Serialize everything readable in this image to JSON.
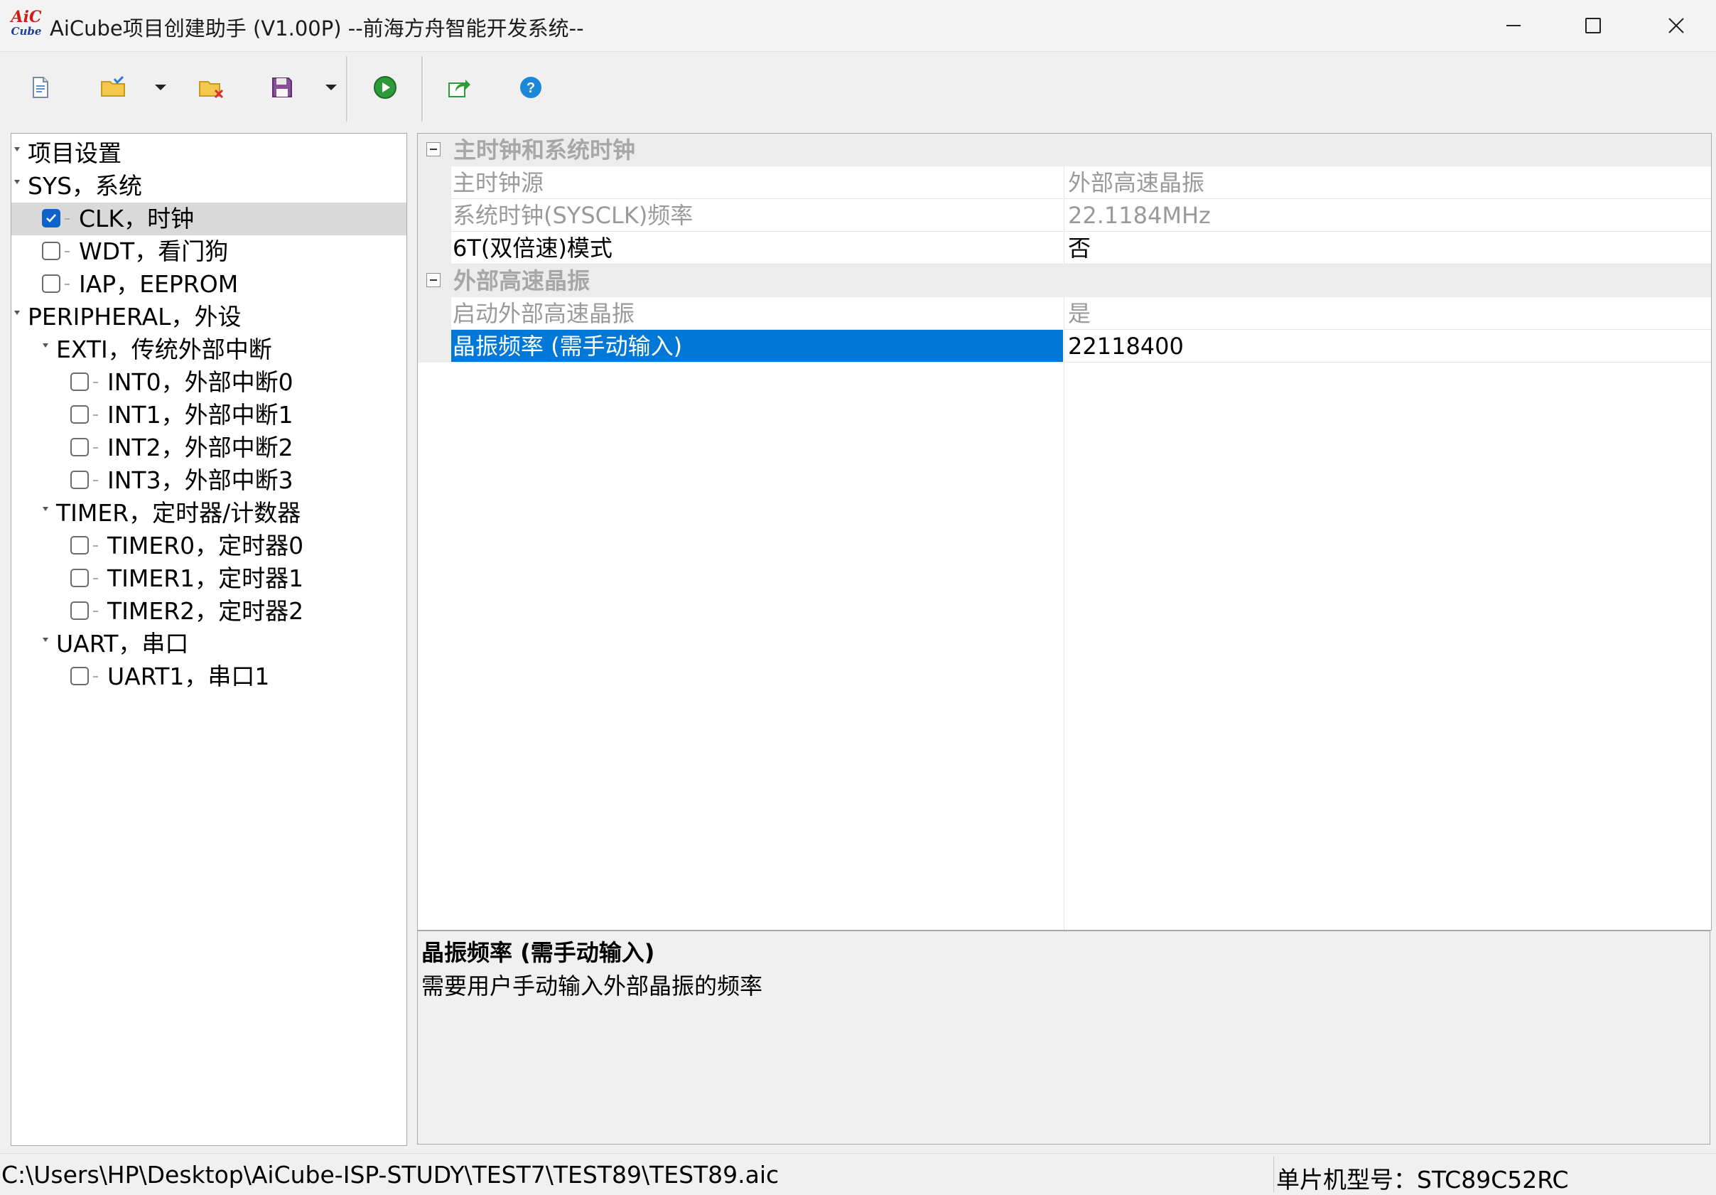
{
  "window": {
    "title": "AiCube项目创建助手 (V1.00P) --前海方舟智能开发系统--",
    "logo_line1": "AiC",
    "logo_line2": "Cube",
    "minimize": "minimize",
    "maximize": "maximize",
    "close": "close"
  },
  "toolbar": {
    "buttons": [
      {
        "name": "new-project",
        "icon": "new-document-icon"
      },
      {
        "name": "open-project",
        "icon": "open-folder-icon"
      },
      {
        "name": "close-project",
        "icon": "folder-delete-icon"
      },
      {
        "name": "save-project",
        "icon": "floppy-disk-icon"
      },
      {
        "name": "generate-code",
        "icon": "play-icon"
      },
      {
        "name": "export",
        "icon": "share-export-icon"
      },
      {
        "name": "help",
        "icon": "help-icon"
      }
    ]
  },
  "tree": {
    "nodes": [
      {
        "label": "项目设置",
        "level": 0,
        "checkbox": false,
        "checked": false,
        "selected": false
      },
      {
        "label": "SYS，系统",
        "level": 0,
        "checkbox": false,
        "checked": false,
        "selected": false
      },
      {
        "label": "CLK，时钟",
        "level": 1,
        "checkbox": true,
        "checked": true,
        "selected": true
      },
      {
        "label": "WDT，看门狗",
        "level": 1,
        "checkbox": true,
        "checked": false,
        "selected": false
      },
      {
        "label": "IAP，EEPROM",
        "level": 1,
        "checkbox": true,
        "checked": false,
        "selected": false
      },
      {
        "label": "PERIPHERAL，外设",
        "level": 0,
        "checkbox": false,
        "checked": false,
        "selected": false
      },
      {
        "label": "EXTI，传统外部中断",
        "level": 1,
        "checkbox": false,
        "checked": false,
        "selected": false
      },
      {
        "label": "INT0，外部中断0",
        "level": 2,
        "checkbox": true,
        "checked": false,
        "selected": false
      },
      {
        "label": "INT1，外部中断1",
        "level": 2,
        "checkbox": true,
        "checked": false,
        "selected": false
      },
      {
        "label": "INT2，外部中断2",
        "level": 2,
        "checkbox": true,
        "checked": false,
        "selected": false
      },
      {
        "label": "INT3，外部中断3",
        "level": 2,
        "checkbox": true,
        "checked": false,
        "selected": false
      },
      {
        "label": "TIMER，定时器/计数器",
        "level": 1,
        "checkbox": false,
        "checked": false,
        "selected": false
      },
      {
        "label": "TIMER0，定时器0",
        "level": 2,
        "checkbox": true,
        "checked": false,
        "selected": false
      },
      {
        "label": "TIMER1，定时器1",
        "level": 2,
        "checkbox": true,
        "checked": false,
        "selected": false
      },
      {
        "label": "TIMER2，定时器2",
        "level": 2,
        "checkbox": true,
        "checked": false,
        "selected": false
      },
      {
        "label": "UART，串口",
        "level": 1,
        "checkbox": false,
        "checked": false,
        "selected": false
      },
      {
        "label": "UART1，串口1",
        "level": 2,
        "checkbox": true,
        "checked": false,
        "selected": false
      }
    ]
  },
  "property_grid": {
    "categories": [
      {
        "label": "主时钟和系统时钟",
        "rows": [
          {
            "name": "主时钟源",
            "value": "外部高速晶振",
            "active": false
          },
          {
            "name": "系统时钟(SYSCLK)频率",
            "value": "22.1184MHz",
            "active": false
          },
          {
            "name": "6T(双倍速)模式",
            "value": "否",
            "active": true
          }
        ]
      },
      {
        "label": "外部高速晶振",
        "rows": [
          {
            "name": "启动外部高速晶振",
            "value": "是",
            "active": false
          },
          {
            "name": "晶振频率 (需手动输入)",
            "value": "22118400",
            "active": true,
            "selected": true,
            "editing": true
          }
        ]
      }
    ]
  },
  "description": {
    "title": "晶振频率 (需手动输入)",
    "text": "需要用户手动输入外部晶振的频率"
  },
  "status": {
    "path": "C:\\Users\\HP\\Desktop\\AiCube-ISP-STUDY\\TEST7\\TEST89\\TEST89.aic",
    "chip": "单片机型号：STC89C52RC"
  },
  "colors": {
    "selection": "#0078d7",
    "checkbox_checked": "#0f62c9",
    "category_bg": "#ececec",
    "inactive_text": "#9a9a9a"
  }
}
